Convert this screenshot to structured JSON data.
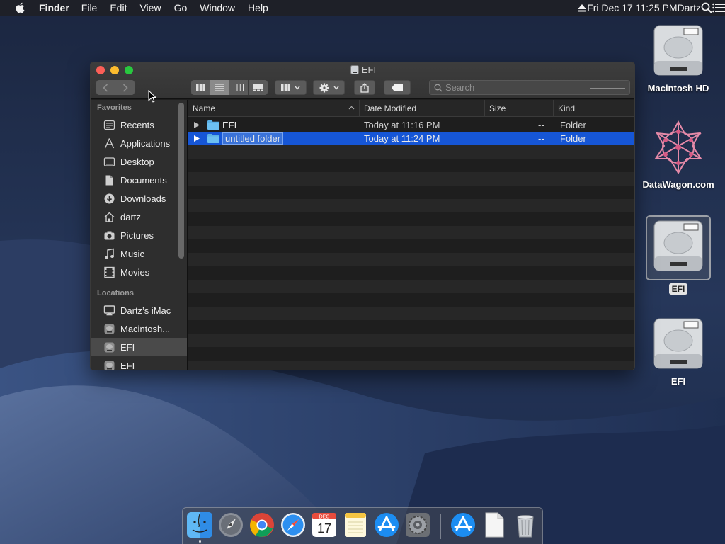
{
  "menubar": {
    "app_name": "Finder",
    "menus": [
      "File",
      "Edit",
      "View",
      "Go",
      "Window",
      "Help"
    ],
    "clock": "Fri Dec 17  11:25 PM",
    "user": "Dartz"
  },
  "desktop": {
    "icons": [
      {
        "label": "Macintosh HD",
        "type": "hard-drive"
      },
      {
        "label": "DataWagon.com",
        "type": "logo"
      },
      {
        "label": "EFI",
        "type": "hard-drive",
        "selected": true
      },
      {
        "label": "EFI",
        "type": "hard-drive"
      }
    ]
  },
  "window": {
    "title": "EFI",
    "search_placeholder": "Search",
    "sidebar": {
      "favorites_header": "Favorites",
      "favorites": [
        "Recents",
        "Applications",
        "Desktop",
        "Documents",
        "Downloads",
        "dartz",
        "Pictures",
        "Music",
        "Movies"
      ],
      "locations_header": "Locations",
      "locations": [
        "Dartz’s iMac",
        "Macintosh...",
        "EFI",
        "EFI"
      ]
    },
    "columns": {
      "name": "Name",
      "date": "Date Modified",
      "size": "Size",
      "kind": "Kind"
    },
    "rows": [
      {
        "name": "EFI",
        "date": "Today at 11:16 PM",
        "size": "--",
        "kind": "Folder"
      },
      {
        "name": "untitled folder",
        "date": "Today at 11:24 PM",
        "size": "--",
        "kind": "Folder",
        "selected": true
      }
    ]
  },
  "dock": {
    "apps": [
      "finder",
      "launchpad",
      "chrome",
      "safari",
      "calendar",
      "notes",
      "app-store",
      "system-preferences",
      "app-store-2",
      "document",
      "trash"
    ],
    "calendar": {
      "month": "DEC",
      "day": "17"
    }
  },
  "colors": {
    "selection": "#1656d6",
    "close": "#fc5f57",
    "minimize": "#fdbc2e",
    "maximize": "#28c83f"
  }
}
